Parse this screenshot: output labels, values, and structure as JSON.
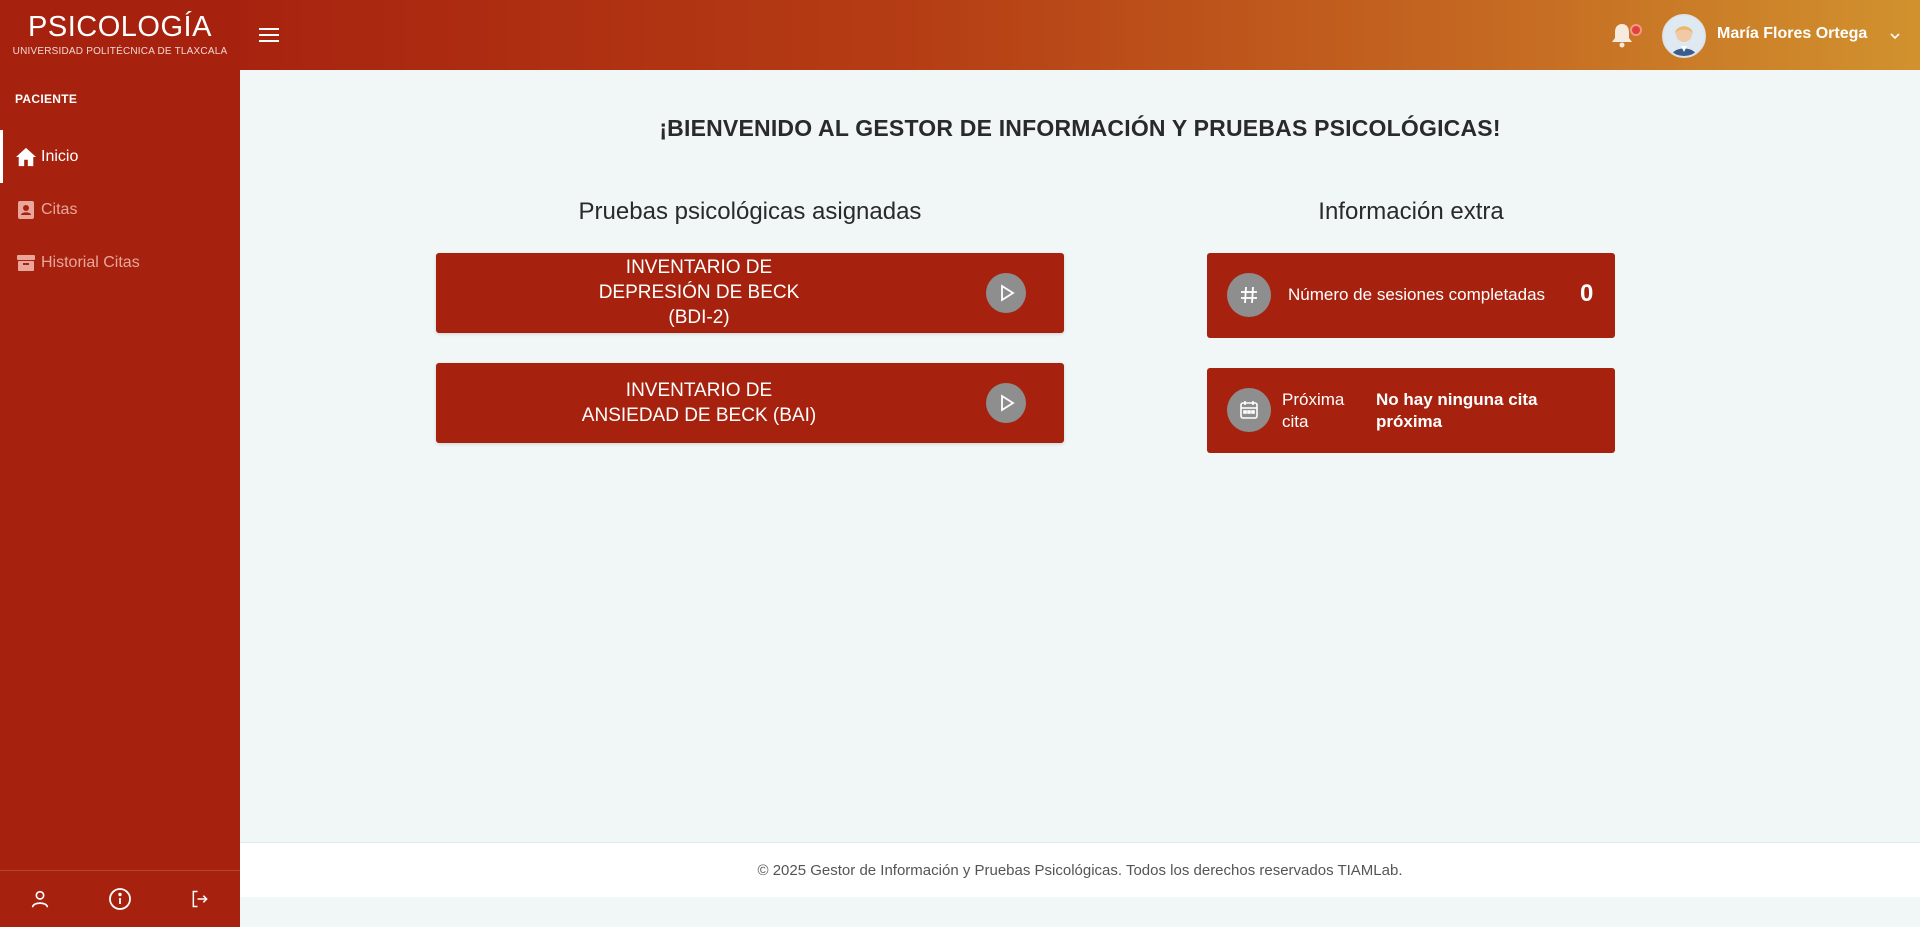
{
  "brand": {
    "title": "PSICOLOGÍA",
    "subtitle": "UNIVERSIDAD POLITÉCNICA DE TLAXCALA"
  },
  "sidebar": {
    "section": "PACIENTE",
    "items": [
      {
        "label": "Inicio",
        "icon": "home-icon",
        "active": true
      },
      {
        "label": "Citas",
        "icon": "contact-book-icon",
        "active": false
      },
      {
        "label": "Historial Citas",
        "icon": "archive-icon",
        "active": false
      }
    ],
    "footer_icons": [
      "user-icon",
      "info-icon",
      "logout-icon"
    ]
  },
  "header": {
    "user_name": "María Flores Ortega",
    "menu_icon": "hamburger-icon",
    "notification_icon": "bell-icon"
  },
  "main": {
    "welcome": "¡BIENVENIDO AL GESTOR DE INFORMACIÓN Y PRUEBAS PSICOLÓGICAS!",
    "tests_title": "Pruebas psicológicas asignadas",
    "tests": [
      {
        "line1": "INVENTARIO DE",
        "line2": "DEPRESIÓN DE BECK",
        "line3": "(BDI-2)"
      },
      {
        "line1": "INVENTARIO DE",
        "line2": "ANSIEDAD DE BECK (BAI)"
      }
    ],
    "info_title": "Información extra",
    "sessions": {
      "label": "Número de sesiones completadas",
      "value": "0"
    },
    "next_appointment": {
      "label_line1": "Próxima",
      "label_line2": "cita",
      "value_line1": "No hay ninguna cita",
      "value_line2": "próxima"
    }
  },
  "footer": {
    "text": "© 2025 Gestor de Información y Pruebas Psicológicas. Todos los derechos reservados TIAMLab."
  },
  "colors": {
    "primary": "#a6220f",
    "header_gradient_end": "#d1922e",
    "background": "#f1f6f6",
    "icon_circle": "#8e8e8e"
  }
}
